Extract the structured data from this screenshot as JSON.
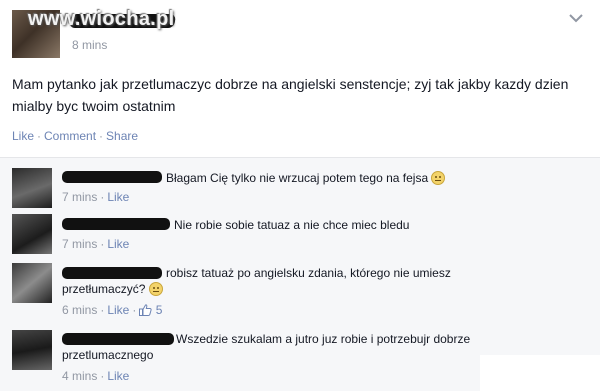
{
  "watermark": "www.wiocha.pl",
  "post": {
    "time": "8 mins",
    "text": "Mam pytanko jak przetlumaczyc dobrze na angielski senstencje; zyj tak jakby kazdy dzien mialby byc twoim ostatnim",
    "actions": {
      "like": "Like",
      "comment": "Comment",
      "share": "Share",
      "separator": "·"
    }
  },
  "comments": [
    {
      "text": "Błagam Cię tylko nie wrzucaj potem tego na fejsa",
      "has_emoji": true,
      "time": "7 mins",
      "like": "Like"
    },
    {
      "text": "Nie robie sobie tatuaz a nie chce miec bledu",
      "has_emoji": false,
      "time": "7 mins",
      "like": "Like"
    },
    {
      "text": "robisz tatuaż po angielsku zdania, którego nie umiesz przetłumaczyć?",
      "has_emoji": true,
      "time": "6 mins",
      "like": "Like",
      "likes_count": "5"
    },
    {
      "text": "Wszedzie szukalam a jutro juz robie i potrzebujr dobrze przetlumacznego",
      "has_emoji": false,
      "time": "4 mins",
      "like": "Like"
    }
  ],
  "colors": {
    "link": "#6d84b4",
    "meta": "#9197a3",
    "text": "#141823",
    "comment_bg": "#f6f7f9"
  }
}
